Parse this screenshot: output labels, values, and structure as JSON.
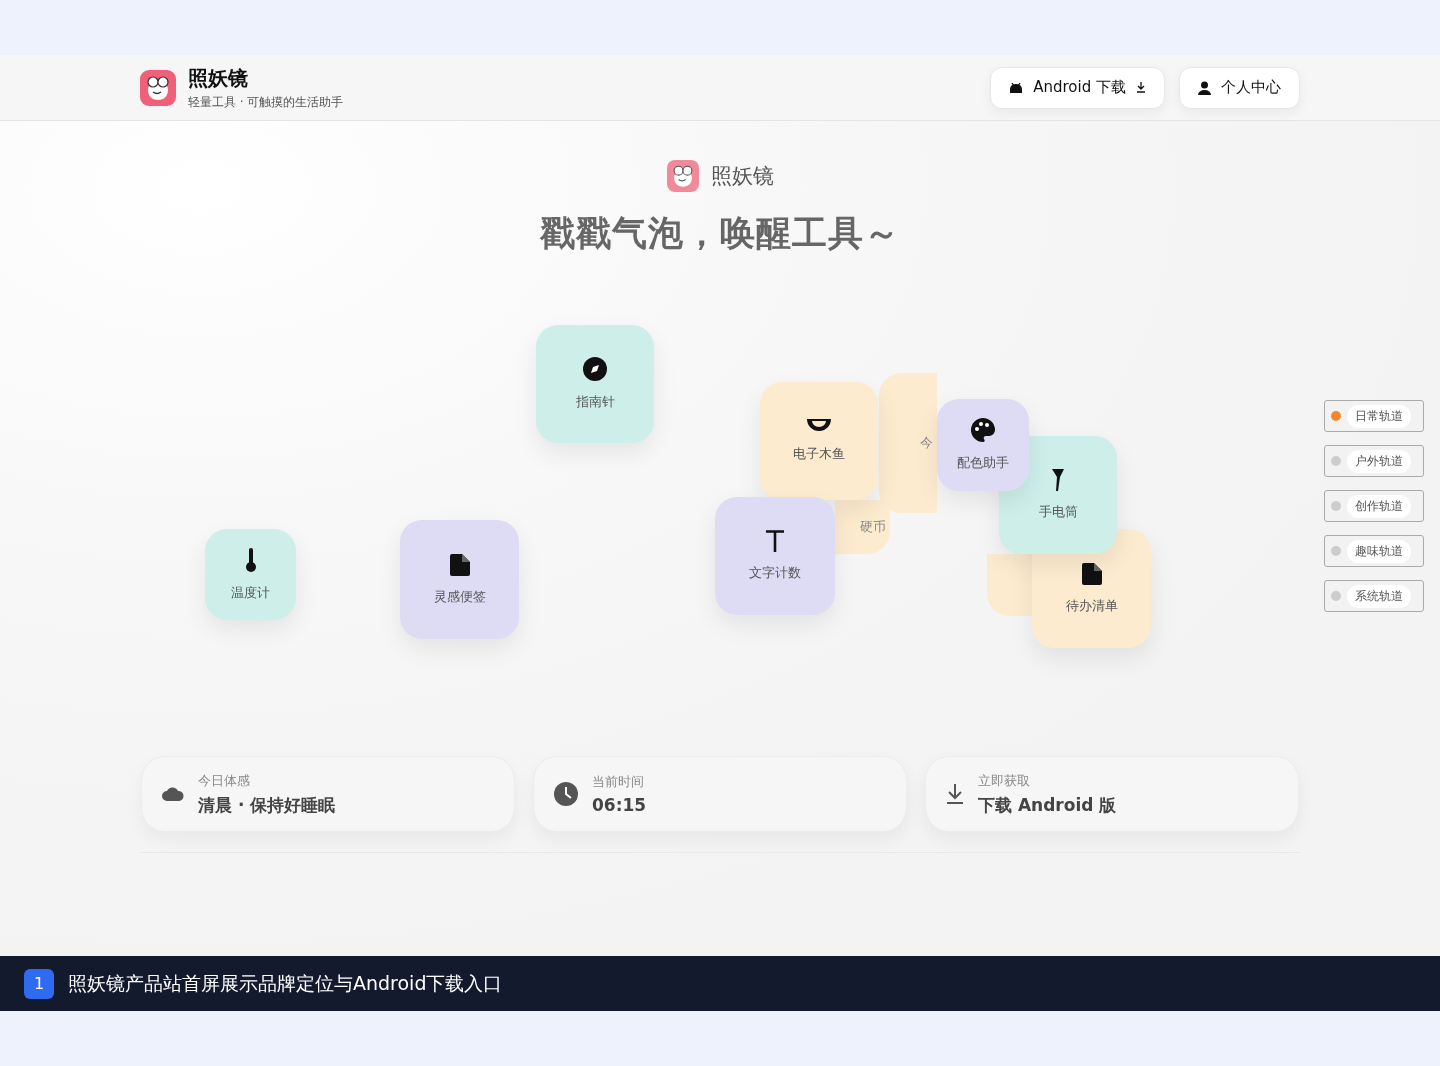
{
  "header": {
    "brand": "照妖镜",
    "tagline": "轻量工具 · 可触摸的生活助手",
    "buttons": [
      {
        "kind": "android",
        "label": "Android 下载"
      },
      {
        "kind": "user",
        "label": "个人中心"
      }
    ]
  },
  "hero": {
    "brand": "照妖镜",
    "headline": "戳戳气泡，唤醒工具～"
  },
  "bubbles": [
    {
      "kind": "compass",
      "color": "#cdeee9",
      "label": "指南针"
    },
    {
      "kind": "thermometer",
      "color": "#cdeee9",
      "label": "温度计"
    },
    {
      "kind": "note",
      "color": "#dedcf4",
      "label": "灵感便签"
    },
    {
      "kind": "hidden",
      "color": "#fdebd0",
      "label": "今"
    },
    {
      "kind": "hidden",
      "color": "#fdebd0",
      "label": "硬币"
    },
    {
      "kind": "hidden",
      "color": "#fdebd0"
    },
    {
      "kind": "bowl",
      "color": "#fdebd0",
      "label": "电子木鱼"
    },
    {
      "kind": "file",
      "color": "#fdebd0",
      "label": "待办清单"
    },
    {
      "kind": "flashlight",
      "color": "#cdeee9",
      "label": "手电筒"
    },
    {
      "kind": "palette",
      "color": "#dedcf4",
      "label": "配色助手"
    },
    {
      "kind": "text",
      "color": "#dedcf4",
      "label": "文字计数"
    }
  ],
  "tracks": [
    {
      "label": "日常轨道",
      "selected": true
    },
    {
      "label": "户外轨道",
      "selected": false
    },
    {
      "label": "创作轨道",
      "selected": false
    },
    {
      "label": "趣味轨道",
      "selected": false
    },
    {
      "label": "系统轨道",
      "selected": false
    }
  ],
  "info_cards": [
    {
      "kind": "weather",
      "caption": "今日体感",
      "value": "清晨 · 保持好睡眠"
    },
    {
      "kind": "clock",
      "caption": "当前时间",
      "value": "06:15"
    },
    {
      "kind": "download",
      "caption": "立即获取",
      "value": "下载 Android 版"
    }
  ],
  "caption_bar": {
    "number": "1",
    "text": "照妖镜产品站首屏展示品牌定位与Android下载入口"
  }
}
